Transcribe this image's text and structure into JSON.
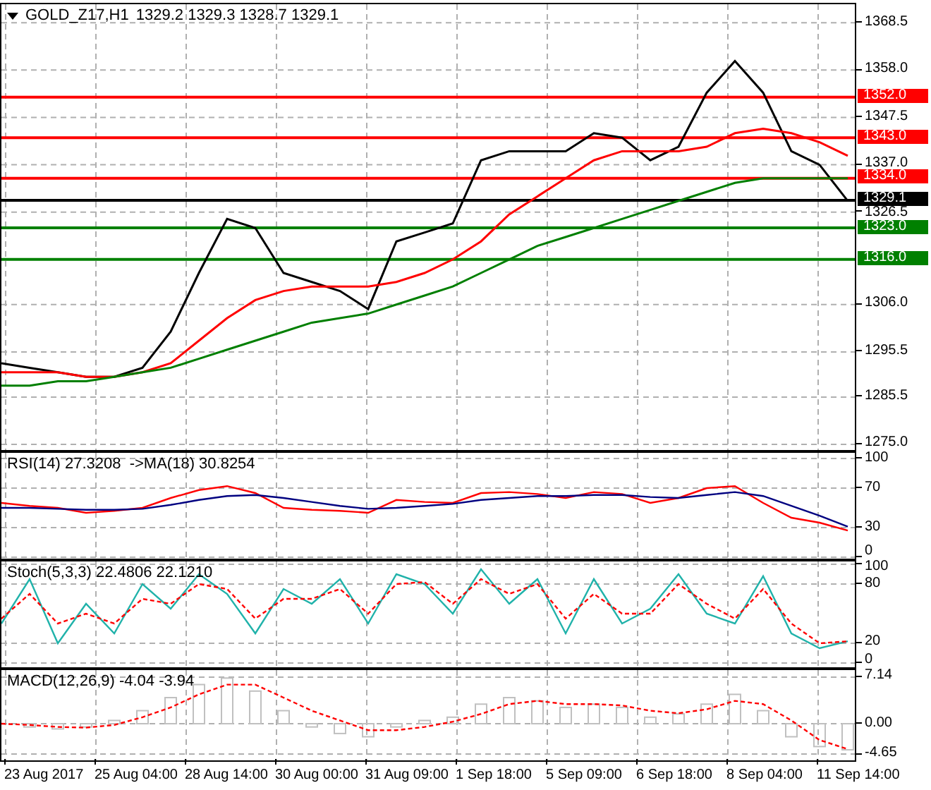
{
  "header": {
    "symbol": "GOLD_Z17,H1",
    "quotes": "1329.2 1329.3 1328.7 1329.1"
  },
  "panes": [
    {
      "kind": "price",
      "chart_data": {
        "type": "line",
        "categories": [
          null,
          null,
          null,
          null,
          null,
          null,
          null,
          null,
          null,
          null,
          null,
          null,
          null,
          null,
          null,
          null,
          null,
          null,
          null,
          null,
          null,
          null,
          null,
          null,
          null,
          null,
          null,
          null,
          null,
          null,
          null
        ],
        "ylim": [
          1273.75,
          1372.6
        ],
        "grid": true,
        "yticks": [
          {
            "value": 1368.5,
            "label": "1368.5"
          },
          {
            "value": 1358,
            "label": "1358.0"
          },
          {
            "value": 1347.5,
            "label": "1347.5"
          },
          {
            "value": 1337,
            "label": "1337.0"
          },
          {
            "value": 1326.5,
            "label": "1326.5"
          },
          {
            "value": 1306,
            "label": "1306.0"
          },
          {
            "value": 1295.5,
            "label": "1295.5"
          },
          {
            "value": 1285.5,
            "label": "1285.5"
          },
          {
            "value": 1275,
            "label": "1275.0"
          }
        ],
        "series": [
          {
            "color": "#000000",
            "values": [
              1293,
              1292,
              1291,
              1290,
              1290,
              1292,
              1300,
              1313,
              1325,
              1323,
              1313,
              1311,
              1309,
              1305,
              1320,
              1322,
              1324,
              1338,
              1340,
              1340,
              1340,
              1344,
              1343,
              1338,
              1341,
              1353,
              1360,
              1353,
              1340,
              1337,
              1329
            ]
          },
          {
            "color": "#ff0000",
            "values": [
              1291,
              1291,
              1291,
              1290,
              1290,
              1291,
              1293,
              1298,
              1303,
              1307,
              1309,
              1310,
              1310,
              1310,
              1311,
              1313,
              1316,
              1320,
              1326,
              1330,
              1334,
              1338,
              1340,
              1340,
              1340,
              1341,
              1344,
              1345,
              1344,
              1342,
              1339
            ]
          },
          {
            "color": "#007f00",
            "values": [
              1288,
              1288,
              1289,
              1289,
              1290,
              1291,
              1292,
              1294,
              1296,
              1298,
              1300,
              1302,
              1303,
              1304,
              1306,
              1308,
              1310,
              1313,
              1316,
              1319,
              1321,
              1323,
              1325,
              1327,
              1329,
              1331,
              1333,
              1334,
              1334,
              1334,
              1334
            ]
          }
        ],
        "ref_lines": [
          {
            "axis": "y",
            "value": 1352.0,
            "label": "1352.0",
            "color": "#ff0000"
          },
          {
            "axis": "y",
            "value": 1343.0,
            "label": "1343.0",
            "color": "#ff0000"
          },
          {
            "axis": "y",
            "value": 1334.0,
            "label": "1334.0",
            "color": "#ff0000"
          },
          {
            "axis": "y",
            "value": 1329.1,
            "label": "1329.1",
            "color": "#000000"
          },
          {
            "axis": "y",
            "value": 1323.0,
            "label": "1323.0",
            "color": "#008000"
          },
          {
            "axis": "y",
            "value": 1316.0,
            "label": "1316.0",
            "color": "#008000"
          }
        ]
      }
    },
    {
      "kind": "rsi",
      "label": "RSI(14) 27.3208  ->MA(18) 30.8254",
      "chart_data": {
        "type": "line",
        "categories": [
          null,
          null,
          null,
          null,
          null,
          null,
          null,
          null,
          null,
          null,
          null,
          null,
          null,
          null,
          null,
          null,
          null,
          null,
          null,
          null,
          null,
          null,
          null,
          null,
          null,
          null,
          null,
          null,
          null,
          null,
          null
        ],
        "ylim": [
          -1.4,
          105.7
        ],
        "grid": true,
        "yticks": [
          100,
          70,
          30,
          0
        ],
        "series": [
          {
            "color": "#ff0000",
            "values": [
              55,
              52,
              50,
              45,
              47,
              50,
              60,
              68,
              72,
              65,
              50,
              48,
              47,
              45,
              58,
              56,
              55,
              65,
              66,
              64,
              60,
              66,
              64,
              55,
              60,
              70,
              72,
              55,
              40,
              35,
              27
            ]
          },
          {
            "color": "#000080",
            "values": [
              50,
              50,
              49,
              48,
              48,
              49,
              53,
              58,
              62,
              63,
              60,
              56,
              52,
              49,
              50,
              52,
              54,
              58,
              60,
              62,
              62,
              63,
              63,
              61,
              60,
              63,
              66,
              62,
              52,
              42,
              31
            ]
          }
        ]
      }
    },
    {
      "kind": "stoch",
      "label": "Stoch(5,3,3) 22.4806 22.1210",
      "chart_data": {
        "type": "line",
        "categories": [
          null,
          null,
          null,
          null,
          null,
          null,
          null,
          null,
          null,
          null,
          null,
          null,
          null,
          null,
          null,
          null,
          null,
          null,
          null,
          null,
          null,
          null,
          null,
          null,
          null,
          null,
          null,
          null,
          null,
          null,
          null
        ],
        "ylim": [
          -4.3,
          102.9
        ],
        "grid": true,
        "yticks": [
          100,
          80,
          20,
          0
        ],
        "series": [
          {
            "color": "#20b2aa",
            "values": [
              40,
              85,
              20,
              60,
              30,
              80,
              55,
              90,
              70,
              30,
              75,
              60,
              85,
              40,
              90,
              80,
              50,
              95,
              60,
              85,
              30,
              85,
              40,
              55,
              90,
              50,
              40,
              88,
              30,
              15,
              22
            ]
          },
          {
            "color": "#ff0000",
            "line_style": "dashed",
            "values": [
              45,
              70,
              40,
              50,
              40,
              65,
              60,
              80,
              75,
              45,
              65,
              65,
              75,
              50,
              80,
              82,
              60,
              85,
              70,
              80,
              45,
              70,
              50,
              50,
              80,
              60,
              45,
              75,
              40,
              20,
              22
            ]
          }
        ]
      }
    },
    {
      "kind": "macd",
      "label": "MACD(12,26,9) -4.04 -3.94",
      "chart_data": {
        "type": "bar",
        "categories": [
          null,
          null,
          null,
          null,
          null,
          null,
          null,
          null,
          null,
          null,
          null,
          null,
          null,
          null,
          null,
          null,
          null,
          null,
          null,
          null,
          null,
          null,
          null,
          null,
          null,
          null,
          null,
          null,
          null,
          null,
          null
        ],
        "ylim": [
          -5.62,
          8.22
        ],
        "grid": true,
        "yticks": [
          7.14,
          {
            "value": 0,
            "label": "0.00"
          },
          -4.65
        ],
        "series": [
          {
            "color": "#c0c0c0",
            "values": [
              0,
              -0.5,
              -0.8,
              -0.5,
              0.5,
              2,
              4,
              6,
              7,
              5,
              2,
              -0.5,
              -1.5,
              -2,
              -0.5,
              0.5,
              1,
              3,
              4,
              3.5,
              2.5,
              3,
              2.5,
              1,
              1.5,
              3,
              4.5,
              2,
              -2,
              -3.5,
              -4
            ]
          },
          {
            "type": "line",
            "color": "#ff0000",
            "line_style": "dashed",
            "values": [
              0,
              -0.2,
              -0.5,
              -0.6,
              -0.2,
              1,
              2.5,
              4.5,
              6,
              6,
              4,
              2,
              0.5,
              -1,
              -1,
              -0.5,
              0.3,
              1.5,
              3,
              3.5,
              3,
              3,
              2.8,
              2,
              1.6,
              2.2,
              3.5,
              3,
              0.5,
              -2.5,
              -3.9
            ]
          }
        ]
      }
    }
  ],
  "time_axis": [
    "23 Aug 2017",
    "25 Aug 04:00",
    "28 Aug 14:00",
    "30 Aug 00:00",
    "31 Aug 09:00",
    "1 Sep 18:00",
    "5 Sep 09:00",
    "6 Sep 18:00",
    "8 Sep 04:00",
    "11 Sep 14:00"
  ]
}
